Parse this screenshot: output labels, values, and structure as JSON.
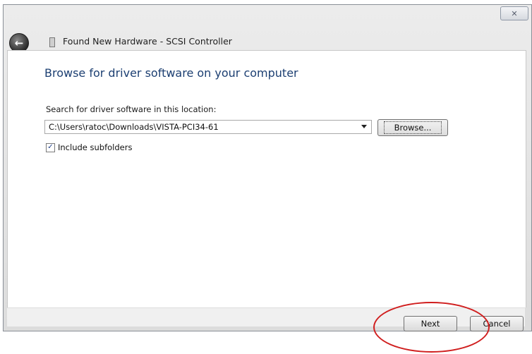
{
  "window": {
    "title": "Found New Hardware - SCSI Controller",
    "close_label": "✕"
  },
  "main": {
    "heading": "Browse for driver software on your computer",
    "search_label": "Search for driver software in this location:",
    "path_value": "C:\\Users\\ratoc\\Downloads\\VISTA-PCI34-61",
    "browse_label": "Browse...",
    "include_subfolders_label": "Include subfolders",
    "include_subfolders_checked": true
  },
  "footer": {
    "next_label": "Next",
    "cancel_label": "Cancel"
  },
  "annotation": {
    "highlight_color": "#d01e1e"
  }
}
